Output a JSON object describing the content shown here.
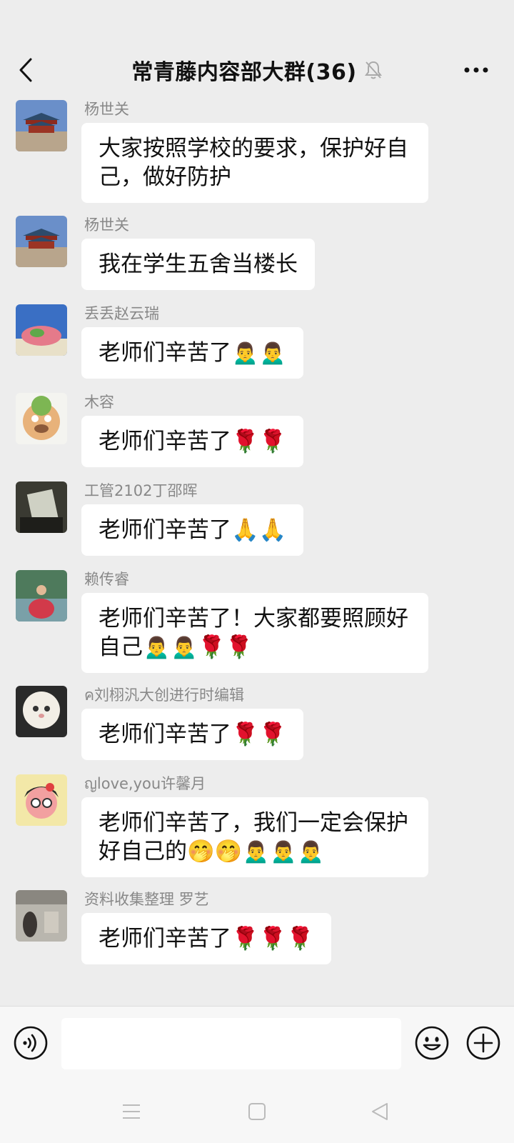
{
  "header": {
    "title": "常青藤内容部大群(36)",
    "back_icon": "chevron-left-icon",
    "mute_icon": "bell-off-icon",
    "more_icon": "more-dots-icon"
  },
  "messages": [
    {
      "name": "杨世关",
      "text": "大家按照学校的要求，保护好自己，做好防护",
      "avatar": "palace-photo"
    },
    {
      "name": "杨世关",
      "text": "我在学生五舍当楼长",
      "avatar": "palace-photo"
    },
    {
      "name": "丢丢赵云瑞",
      "text": "老师们辛苦了🙍‍♂️🙍‍♂️",
      "avatar": "starfish-cartoon"
    },
    {
      "name": "木容",
      "text": "老师们辛苦了🌹🌹",
      "avatar": "cartoon-face"
    },
    {
      "name": "工管2102丁邵晖",
      "text": "老师们辛苦了🙏🙏",
      "avatar": "photo"
    },
    {
      "name": "赖传睿",
      "text": "老师们辛苦了！大家都要照顾好自己🙍‍♂️🙍‍♂️🌹🌹",
      "avatar": "photo"
    },
    {
      "name": "ค刘栩汎大创进行时编辑",
      "text": "老师们辛苦了🌹🌹",
      "avatar": "cat-photo"
    },
    {
      "name": "ญlove,you许馨月",
      "text": "老师们辛苦了，我们一定会保护好自己的🤭🤭🙍‍♂️🙍‍♂️🙍‍♂️",
      "avatar": "cartoon-girl"
    },
    {
      "name": "资料收集整理 罗艺",
      "text": "老师们辛苦了🌹🌹🌹",
      "avatar": "photo"
    }
  ],
  "composer": {
    "voice_icon": "voice-icon",
    "input_value": "",
    "emoji_icon": "emoji-icon",
    "plus_icon": "plus-icon"
  },
  "nav": {
    "menu_icon": "menu-icon",
    "home_icon": "home-square-icon",
    "back_icon": "back-triangle-icon"
  },
  "colors": {
    "background": "#ededed",
    "bubble": "#ffffff",
    "name_text": "#888888"
  }
}
